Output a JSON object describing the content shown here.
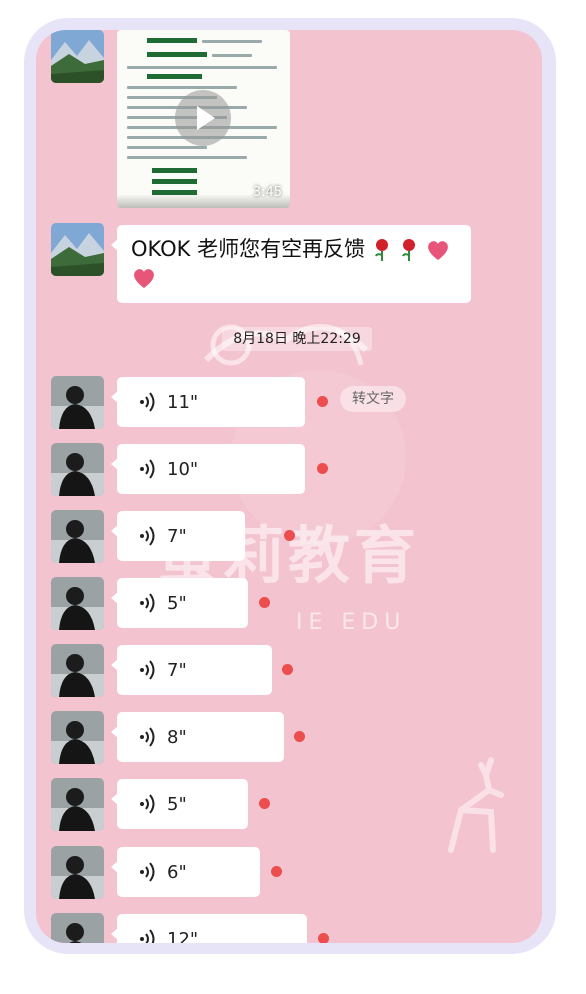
{
  "chat": {
    "video": {
      "duration": "3:45"
    },
    "text_message": {
      "text": "OKOK 老师您有空再反馈"
    },
    "timestamp": "8月18日 晚上22:29",
    "voice_messages": [
      {
        "duration": "11\""
      },
      {
        "duration": "10\""
      },
      {
        "duration": "7\""
      },
      {
        "duration": "5\""
      },
      {
        "duration": "7\""
      },
      {
        "duration": "8\""
      },
      {
        "duration": "5\""
      },
      {
        "duration": "6\""
      },
      {
        "duration": "12\""
      }
    ],
    "transcribe_label": "转文字",
    "unread_dot_color": "#ec4d4d"
  },
  "watermark": {
    "title": "蜜莉教育",
    "subtitle": "IE EDU"
  }
}
